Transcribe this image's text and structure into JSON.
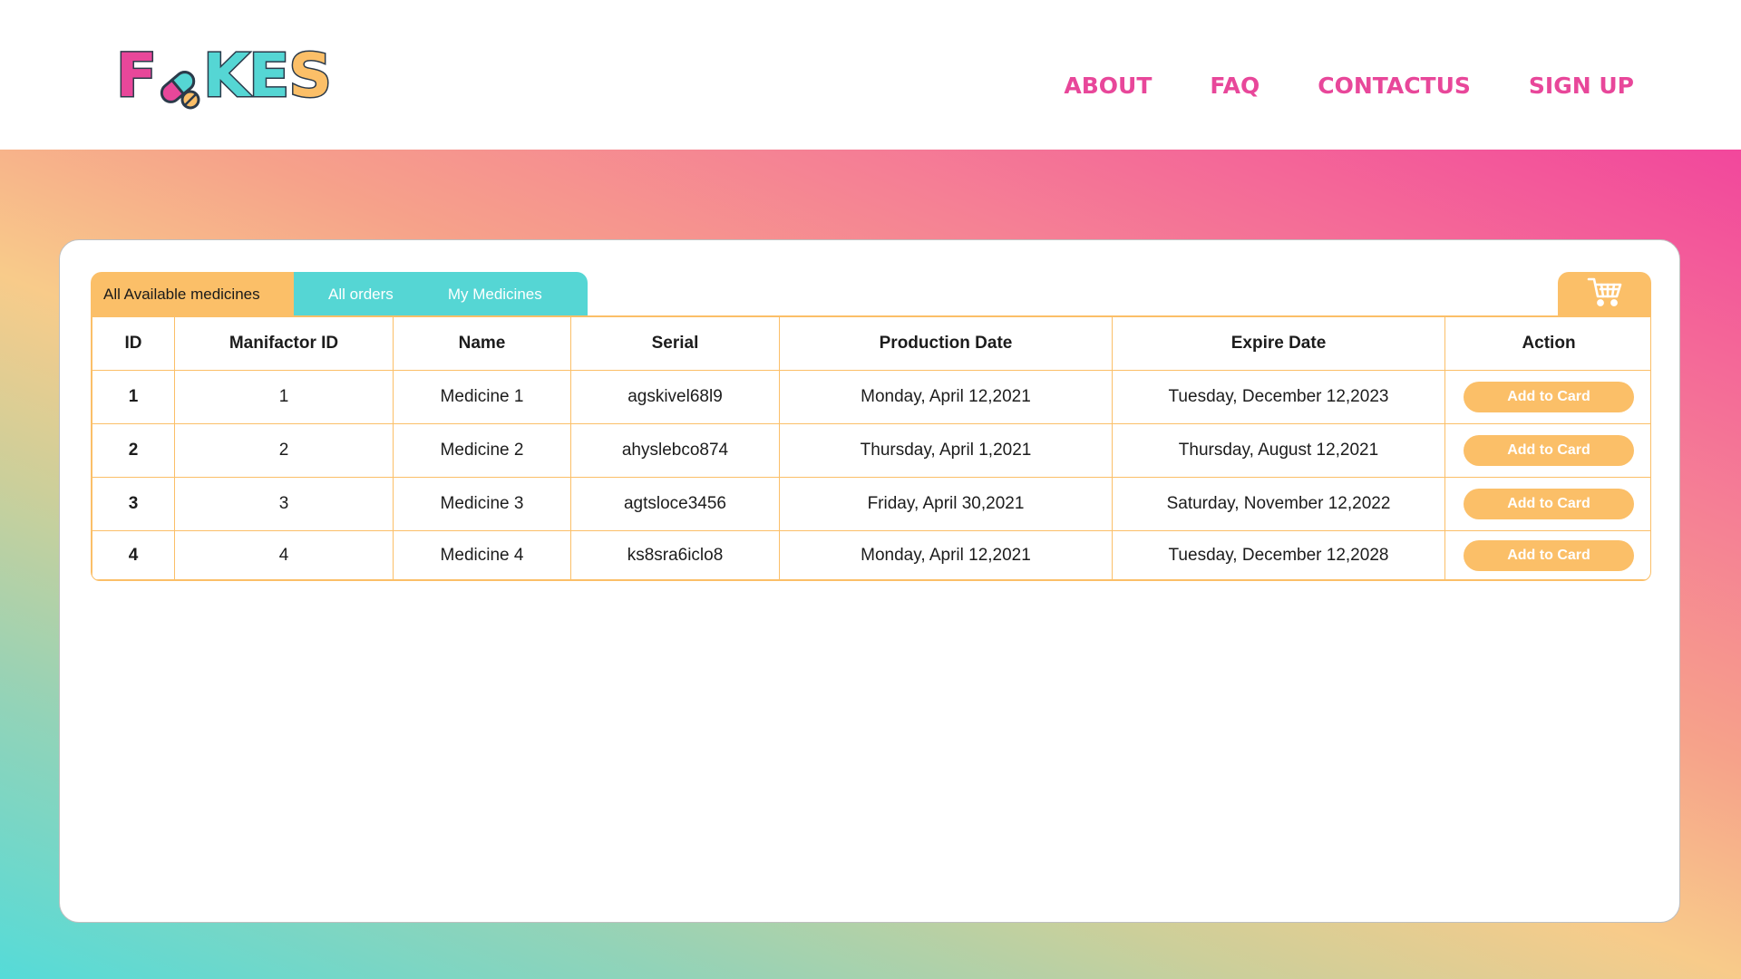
{
  "brand": {
    "name": "FAKES",
    "letters": [
      "F",
      "K",
      "E",
      "S"
    ],
    "colors": {
      "pink": "#e8479a",
      "teal": "#55d6d4",
      "orange": "#fbbf68"
    }
  },
  "nav": {
    "items": [
      {
        "label": "ABOUT"
      },
      {
        "label": "FAQ"
      },
      {
        "label": "CONTACTUS"
      },
      {
        "label": "SIGN UP"
      }
    ]
  },
  "tabs": {
    "active": "All Available medicines",
    "items": [
      {
        "label": "All Available medicines"
      },
      {
        "label": "All orders"
      },
      {
        "label": "My Medicines"
      }
    ]
  },
  "cart": {
    "icon": "shopping-cart-icon"
  },
  "table": {
    "columns": [
      "ID",
      "Manifactor ID",
      "Name",
      "Serial",
      "Production Date",
      "Expire Date",
      "Action"
    ],
    "rows": [
      {
        "id": "1",
        "manufacturer_id": "1",
        "name": "Medicine 1",
        "serial": "agskivel68l9",
        "production_date": "Monday, April 12,2021",
        "expire_date": "Tuesday, December 12,2023",
        "action": "Add to Card"
      },
      {
        "id": "2",
        "manufacturer_id": "2",
        "name": "Medicine 2",
        "serial": "ahyslebco874",
        "production_date": "Thursday, April 1,2021",
        "expire_date": "Thursday, August 12,2021",
        "action": "Add to Card"
      },
      {
        "id": "3",
        "manufacturer_id": "3",
        "name": "Medicine 3",
        "serial": "agtsloce3456",
        "production_date": "Friday, April 30,2021",
        "expire_date": "Saturday, November 12,2022",
        "action": "Add to Card"
      },
      {
        "id": "4",
        "manufacturer_id": "4",
        "name": "Medicine 4",
        "serial": "ks8sra6iclo8",
        "production_date": "Monday, April 12,2021",
        "expire_date": "Tuesday, December 12,2028",
        "action": "Add to Card"
      }
    ]
  }
}
